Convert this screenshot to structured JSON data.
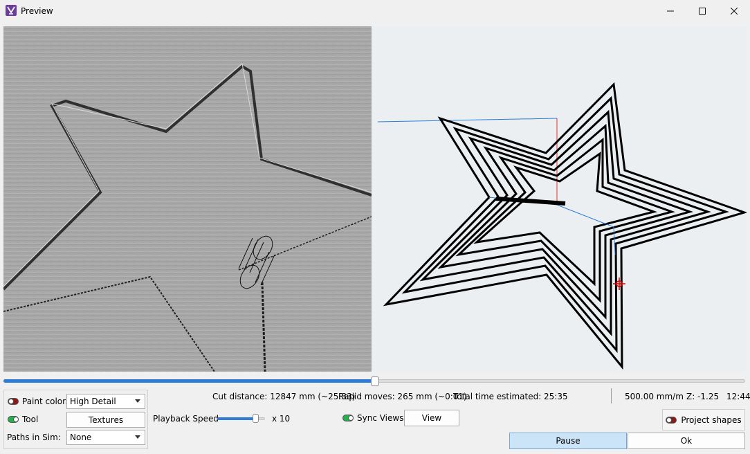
{
  "window": {
    "title": "Preview",
    "app_icon": "app-logo-icon",
    "controls": [
      "minimize-icon",
      "maximize-icon",
      "close-icon"
    ]
  },
  "playback": {
    "progress": 0.5
  },
  "options": {
    "paint_colors_label": "Paint colors",
    "paint_colors_on": false,
    "paint_colors_value": "High Detail",
    "tool_label": "Tool",
    "tool_on": true,
    "textures_label": "Textures",
    "paths_label": "Paths in Sim:",
    "paths_value": "None"
  },
  "speed": {
    "label": "Playback Speed",
    "value_text": "x 10",
    "level": 0.8
  },
  "stats": {
    "cut_distance": "Cut distance: 12847 mm (~25:33)",
    "rapid_moves": "Rapid moves: 265 mm (~0:01)",
    "total_time": "Total time estimated: 25:35"
  },
  "status": {
    "feed_rate": "500.00 mm/m",
    "z_position": "Z: -1.25",
    "time": "12:44"
  },
  "sync": {
    "label": "Sync Views",
    "on": true,
    "view_button": "View"
  },
  "project_shapes": {
    "label": "Project shapes",
    "on": false
  },
  "actions": {
    "pause": "Pause",
    "ok": "Ok"
  },
  "colors": {
    "accent": "#2c7bd6",
    "toggle_on": "#22b14c",
    "toggle_off": "#8b1a1a",
    "pause_bg": "#cce4f7"
  }
}
